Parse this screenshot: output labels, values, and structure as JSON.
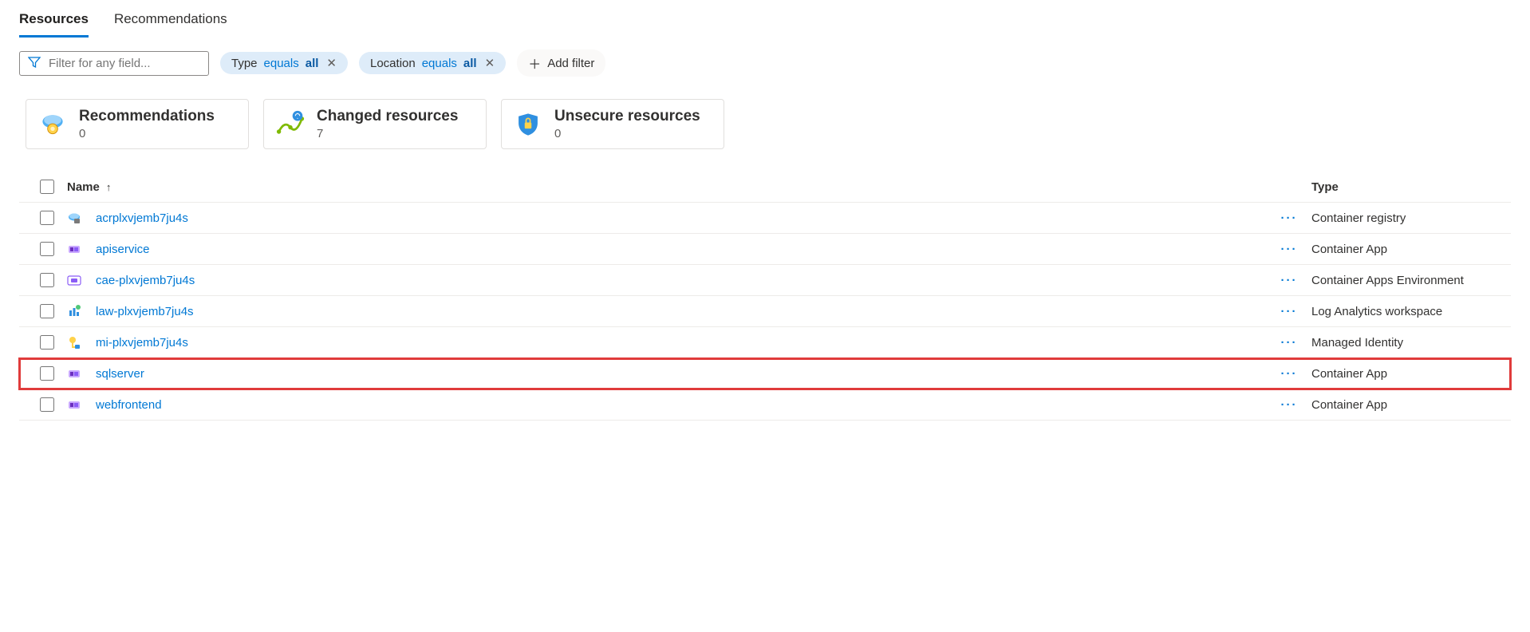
{
  "tabs": {
    "resources": "Resources",
    "recommendations": "Recommendations"
  },
  "filterBar": {
    "placeholder": "Filter for any field...",
    "typePill": {
      "field": "Type",
      "operator": "equals",
      "value": "all"
    },
    "locationPill": {
      "field": "Location",
      "operator": "equals",
      "value": "all"
    },
    "addFilter": "Add filter"
  },
  "cards": {
    "recommendations": {
      "title": "Recommendations",
      "count": "0"
    },
    "changed": {
      "title": "Changed resources",
      "count": "7"
    },
    "unsecure": {
      "title": "Unsecure resources",
      "count": "0"
    }
  },
  "columns": {
    "name": "Name",
    "type": "Type"
  },
  "rows": [
    {
      "name": "acrplxvjemb7ju4s",
      "type": "Container registry",
      "icon": "registry",
      "highlighted": false
    },
    {
      "name": "apiservice",
      "type": "Container App",
      "icon": "containerapp",
      "highlighted": false
    },
    {
      "name": "cae-plxvjemb7ju4s",
      "type": "Container Apps Environment",
      "icon": "caenv",
      "highlighted": false
    },
    {
      "name": "law-plxvjemb7ju4s",
      "type": "Log Analytics workspace",
      "icon": "law",
      "highlighted": false
    },
    {
      "name": "mi-plxvjemb7ju4s",
      "type": "Managed Identity",
      "icon": "identity",
      "highlighted": false
    },
    {
      "name": "sqlserver",
      "type": "Container App",
      "icon": "containerapp",
      "highlighted": true
    },
    {
      "name": "webfrontend",
      "type": "Container App",
      "icon": "containerapp",
      "highlighted": false
    }
  ]
}
